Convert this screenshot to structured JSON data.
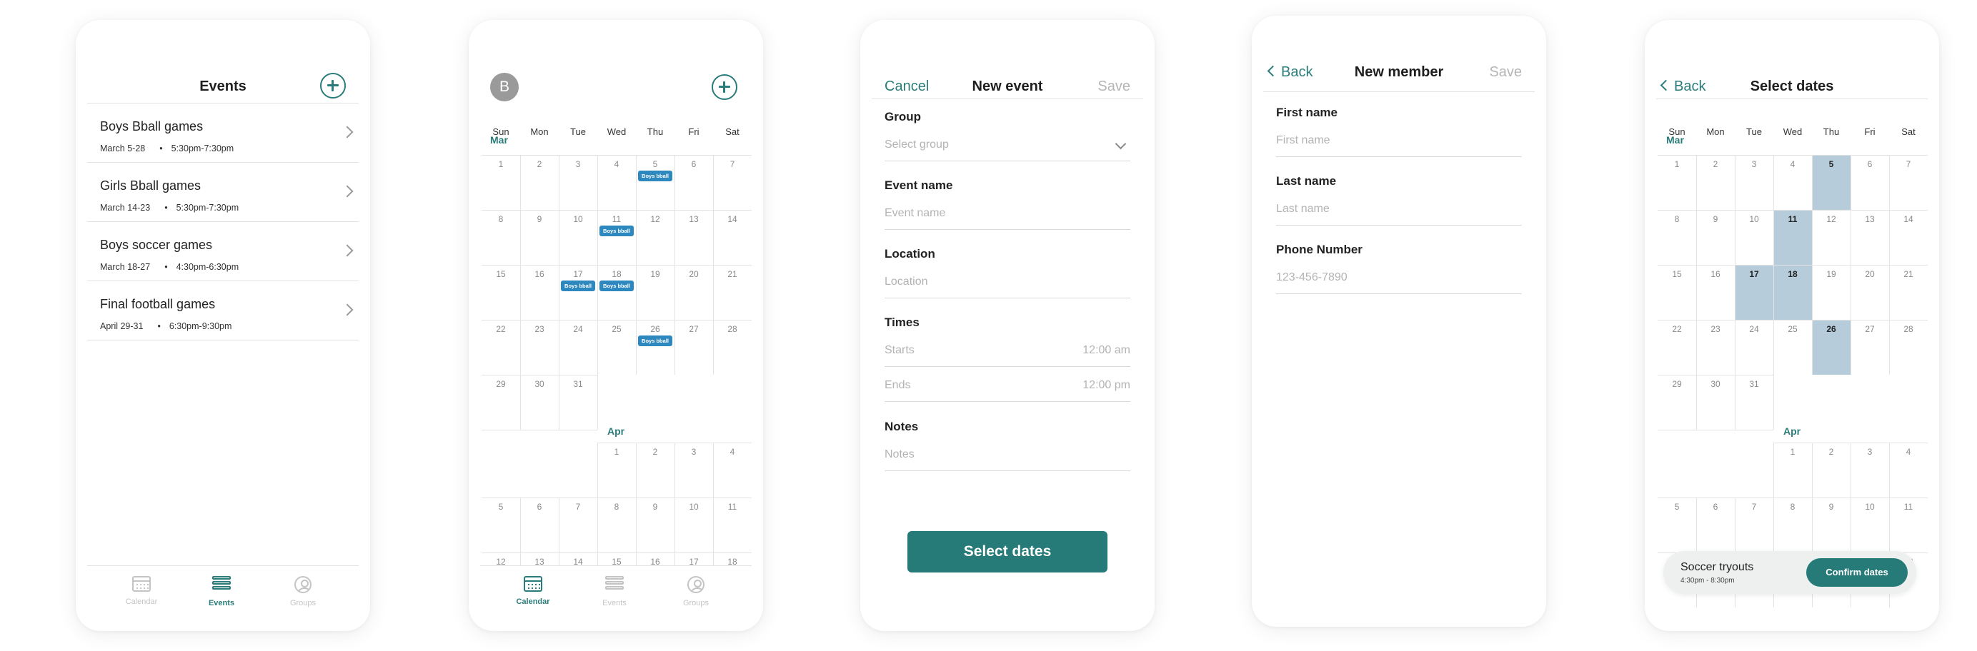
{
  "colors": {
    "accent": "#2a7c7a",
    "event_chip": "#2d88bf",
    "selected_day": "#b7ccda",
    "muted": "#b5b5b5"
  },
  "tabbar": {
    "calendar": "Calendar",
    "events": "Events",
    "groups": "Groups"
  },
  "events_screen": {
    "title": "Events",
    "items": [
      {
        "name": "Boys Bball games",
        "dates": "March 5-28",
        "time": "5:30pm-7:30pm"
      },
      {
        "name": "Girls Bball games",
        "dates": "March 14-23",
        "time": "5:30pm-7:30pm"
      },
      {
        "name": "Boys soccer games",
        "dates": "March 18-27",
        "time": "4:30pm-6:30pm"
      },
      {
        "name": "Final football games",
        "dates": "April 29-31",
        "time": "6:30pm-9:30pm"
      }
    ]
  },
  "calendar_screen": {
    "avatar_initial": "B",
    "weekdays": [
      "Sun",
      "Mon",
      "Tue",
      "Wed",
      "Thu",
      "Fri",
      "Sat"
    ],
    "months": [
      "Mar",
      "Apr"
    ],
    "event_chip_label": "Boys bball"
  },
  "new_event_screen": {
    "cancel": "Cancel",
    "title": "New event",
    "save": "Save",
    "group_label": "Group",
    "group_placeholder": "Select group",
    "name_label": "Event name",
    "name_placeholder": "Event name",
    "location_label": "Location",
    "location_placeholder": "Location",
    "times_label": "Times",
    "starts_label": "Starts",
    "starts_value": "12:00 am",
    "ends_label": "Ends",
    "ends_value": "12:00 pm",
    "notes_label": "Notes",
    "notes_placeholder": "Notes",
    "select_dates_button": "Select dates"
  },
  "new_member_screen": {
    "back": "Back",
    "title": "New member",
    "save": "Save",
    "first_label": "First name",
    "first_placeholder": "First name",
    "last_label": "Last name",
    "last_placeholder": "Last name",
    "phone_label": "Phone Number",
    "phone_placeholder": "123-456-7890"
  },
  "select_dates_screen": {
    "back": "Back",
    "title": "Select dates",
    "weekdays": [
      "Sun",
      "Mon",
      "Tue",
      "Wed",
      "Thu",
      "Fri",
      "Sat"
    ],
    "months": [
      "Mar",
      "Apr"
    ],
    "selected_days": [
      "5",
      "11",
      "17",
      "18",
      "26"
    ],
    "event_title": "Soccer tryouts",
    "event_time": "4:30pm - 8:30pm",
    "confirm_button": "Confirm dates"
  }
}
